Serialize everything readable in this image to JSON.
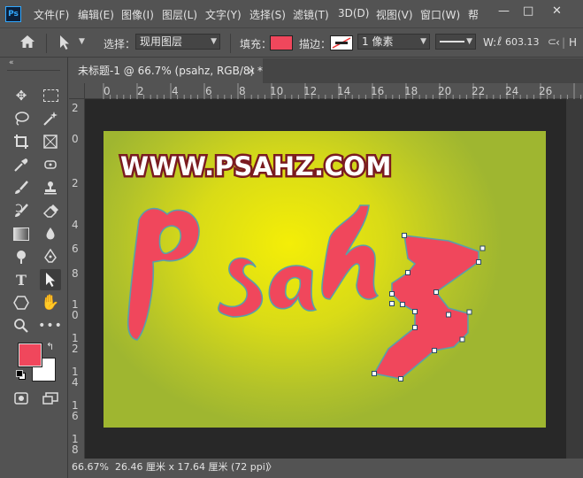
{
  "app": {
    "logo": "Ps"
  },
  "menu": [
    "文件(F)",
    "编辑(E)",
    "图像(I)",
    "图层(L)",
    "文字(Y)",
    "选择(S)",
    "滤镜(T)",
    "3D(D)",
    "视图(V)",
    "窗口(W)",
    "帮"
  ],
  "window_controls": {
    "minimize": "—",
    "restore": "□",
    "close": "✕"
  },
  "options": {
    "select_label": "选择：",
    "select_value": "现用图层",
    "fill_label": "填充：",
    "stroke_label": "描边：",
    "stroke_width": "1 像素",
    "width_label": "W:",
    "width_value": "603.13",
    "h_label": "H",
    "fill_color": "#f0475c",
    "stroke_color": "#ffffff"
  },
  "document": {
    "tab_title": "未标题-1 @ 66.7% (psahz, RGB/8) *",
    "close": "×"
  },
  "ruler": {
    "top_labels": [
      "0",
      "2",
      "4",
      "6",
      "8",
      "10",
      "12",
      "14",
      "16",
      "18",
      "20",
      "22",
      "24",
      "26"
    ],
    "left_labels": [
      "2",
      "0",
      "2",
      "4",
      "6",
      "8",
      "1\n0",
      "1\n2",
      "1\n4",
      "1\n6",
      "1\n8"
    ]
  },
  "canvas": {
    "watermark": "WWW.PSAHZ.COM",
    "text_layer": "psahz",
    "text_color": "#f0475c",
    "background_center": "#f4ee07",
    "background_edge": "#9fb630"
  },
  "colors": {
    "foreground": "#f0475c",
    "background": "#ffffff"
  },
  "status": {
    "zoom": "66.67%",
    "doc_size": "26.46 厘米 x 17.64 厘米 (72 ppi)",
    "arrow": "〉"
  }
}
